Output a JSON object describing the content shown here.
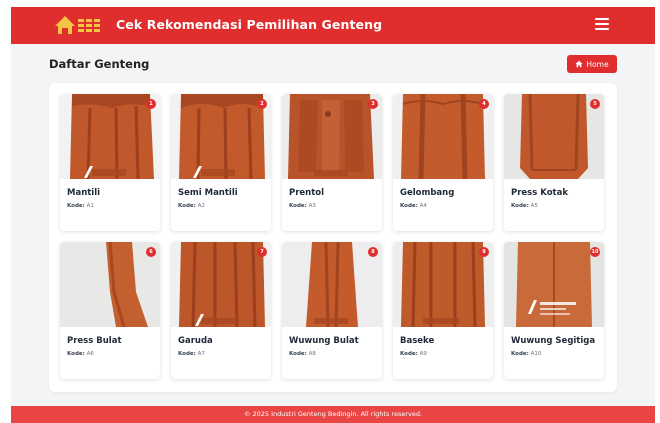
{
  "header": {
    "title": "Cek Rekomendasi Pemilihan Genteng",
    "logo_icon": "roof-tile-logo-icon",
    "menu_icon": "hamburger-menu-icon"
  },
  "page": {
    "title": "Daftar Genteng",
    "home_label": "Home",
    "home_icon": "home-icon"
  },
  "code_label": "Kode:",
  "tiles": [
    {
      "badge": "1",
      "name": "Mantili",
      "code": "A1"
    },
    {
      "badge": "2",
      "name": "Semi Mantili",
      "code": "A2"
    },
    {
      "badge": "3",
      "name": "Prentol",
      "code": "A3"
    },
    {
      "badge": "4",
      "name": "Gelombang",
      "code": "A4"
    },
    {
      "badge": "5",
      "name": "Press Kotak",
      "code": "A5"
    },
    {
      "badge": "6",
      "name": "Press Bulat",
      "code": "A6"
    },
    {
      "badge": "7",
      "name": "Garuda",
      "code": "A7"
    },
    {
      "badge": "8",
      "name": "Wuwung Bulat",
      "code": "A8"
    },
    {
      "badge": "9",
      "name": "Baseke",
      "code": "A9"
    },
    {
      "badge": "10",
      "name": "Wuwung Segitiga",
      "code": "A10"
    }
  ],
  "footer": {
    "text": "© 2025 Industri Genteng Bedingin. All rights reserved."
  },
  "colors": {
    "primary": "#e02d2d",
    "footer": "#e94545",
    "tile": "#c0582b"
  }
}
